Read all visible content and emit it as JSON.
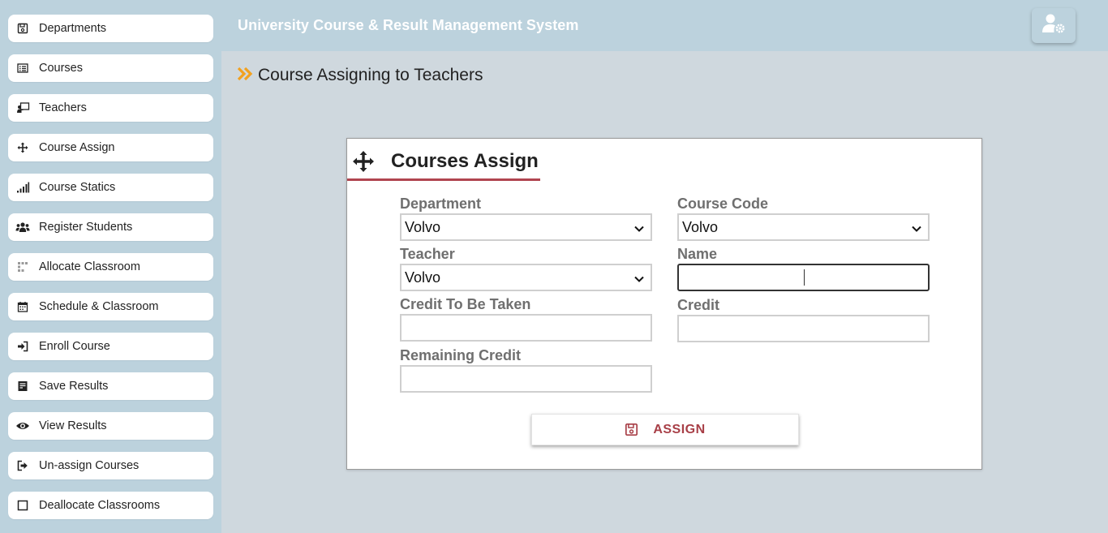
{
  "sidebar": {
    "items": [
      {
        "label": "Departments",
        "icon": "save-icon"
      },
      {
        "label": "Courses",
        "icon": "list-icon"
      },
      {
        "label": "Teachers",
        "icon": "chalkboard-teacher-icon"
      },
      {
        "label": "Course Assign",
        "icon": "move-icon"
      },
      {
        "label": "Course Statics",
        "icon": "signal-icon"
      },
      {
        "label": "Register Students",
        "icon": "users-icon"
      },
      {
        "label": "Allocate Classroom",
        "icon": "grid-icon"
      },
      {
        "label": "Schedule & Classroom",
        "icon": "calendar-icon"
      },
      {
        "label": "Enroll Course",
        "icon": "sign-in-icon"
      },
      {
        "label": "Save Results",
        "icon": "document-icon"
      },
      {
        "label": "View Results",
        "icon": "eye-icon"
      },
      {
        "label": "Un-assign Courses",
        "icon": "sign-out-icon"
      },
      {
        "label": "Deallocate Classrooms",
        "icon": "square-icon"
      }
    ]
  },
  "header": {
    "title": "University Course & Result Management System",
    "user_icon": "user-cog-icon"
  },
  "page": {
    "title": "Course Assigning to Teachers",
    "title_icon": "double-chevron-right-icon"
  },
  "form": {
    "heading": "Courses Assign",
    "heading_icon": "arrows-move-icon",
    "department": {
      "label": "Department",
      "value": "Volvo"
    },
    "course_code": {
      "label": "Course Code",
      "value": "Volvo"
    },
    "teacher": {
      "label": "Teacher",
      "value": "Volvo"
    },
    "name": {
      "label": "Name",
      "value": ""
    },
    "credit_to_be_taken": {
      "label": "Credit To Be Taken",
      "value": ""
    },
    "credit": {
      "label": "Credit",
      "value": ""
    },
    "remaining_credit": {
      "label": "Remaining Credit",
      "value": ""
    },
    "assign_button": {
      "label": "ASSIGN",
      "icon": "save-icon"
    }
  },
  "colors": {
    "accent": "#b04550",
    "chevron": "#f2a11f",
    "sidebar_bg": "#bcd2dd",
    "content_bg": "#cfd8de"
  }
}
